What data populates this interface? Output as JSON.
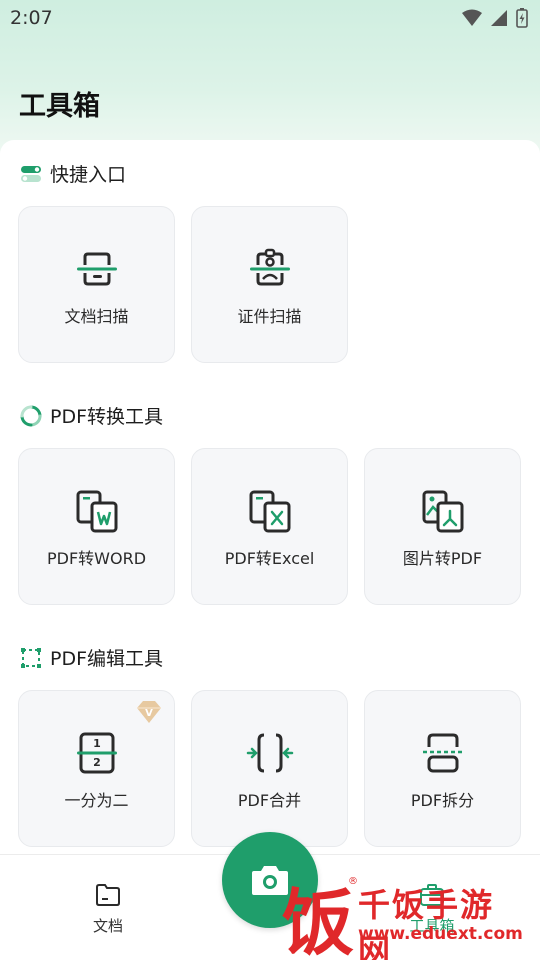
{
  "status_bar": {
    "time": "2:07"
  },
  "page": {
    "title": "工具箱"
  },
  "sections": [
    {
      "title": "快捷入口",
      "cards": [
        {
          "label": "文档扫描",
          "icon": "doc-scan-icon"
        },
        {
          "label": "证件扫描",
          "icon": "id-scan-icon"
        }
      ]
    },
    {
      "title": "PDF转换工具",
      "cards": [
        {
          "label": "PDF转WORD",
          "icon": "pdf-to-word-icon"
        },
        {
          "label": "PDF转Excel",
          "icon": "pdf-to-excel-icon"
        },
        {
          "label": "图片转PDF",
          "icon": "image-to-pdf-icon"
        }
      ]
    },
    {
      "title": "PDF编辑工具",
      "cards": [
        {
          "label": "一分为二",
          "icon": "split-in-two-icon",
          "badge": "V"
        },
        {
          "label": "PDF合并",
          "icon": "merge-icon"
        },
        {
          "label": "PDF拆分",
          "icon": "split-icon"
        }
      ]
    }
  ],
  "bottom_nav": {
    "items": [
      {
        "label": "文档",
        "icon": "folder-icon"
      },
      {
        "label": "工具箱",
        "icon": "toolbox-icon"
      }
    ],
    "fab_icon": "camera-icon"
  },
  "watermark": {
    "big_char": "饭",
    "name": "千饭手游网",
    "url": "www.eduext.com",
    "reg": "®"
  },
  "colors": {
    "accent": "#1f9e6b",
    "watermark": "#e0282a"
  }
}
